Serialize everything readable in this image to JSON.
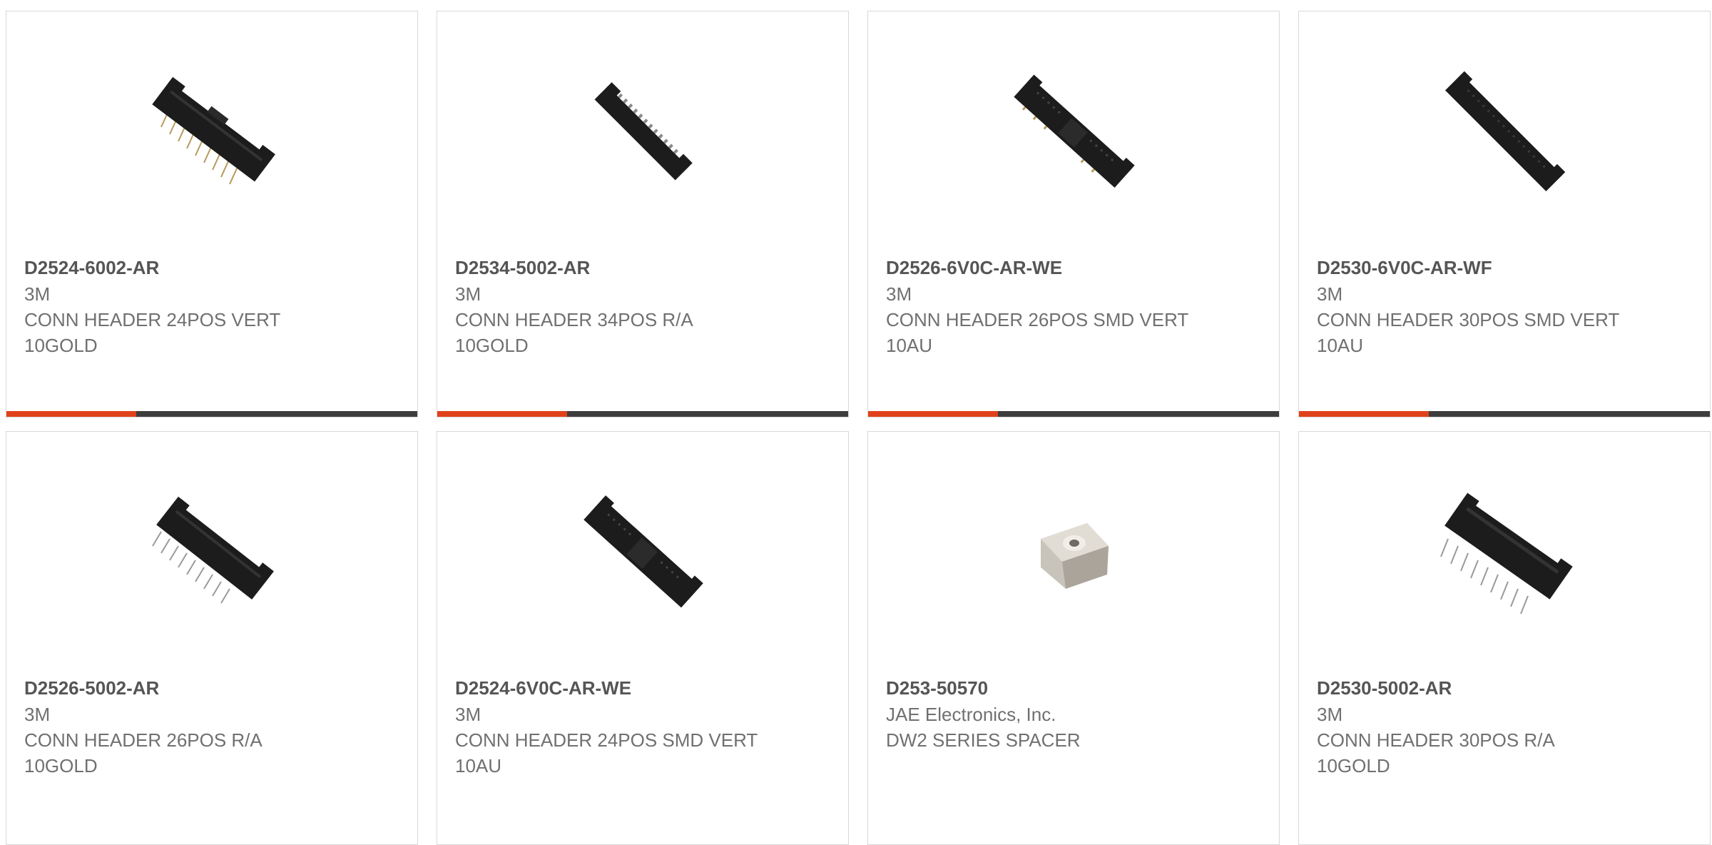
{
  "accent_color": "#e0421a",
  "bar_color": "#3d3d3d",
  "products": [
    {
      "part_number": "D2524-6002-AR",
      "manufacturer": "3M",
      "description": "CONN HEADER 24POS VERT 10GOLD",
      "image": "vertical-header-connector-image"
    },
    {
      "part_number": "D2534-5002-AR",
      "manufacturer": "3M",
      "description": "CONN HEADER 34POS R/A 10GOLD",
      "image": "right-angle-header-connector-image"
    },
    {
      "part_number": "D2526-6V0C-AR-WE",
      "manufacturer": "3M",
      "description": "CONN HEADER 26POS SMD VERT 10AU",
      "image": "smd-header-connector-image"
    },
    {
      "part_number": "D2530-6V0C-AR-WF",
      "manufacturer": "3M",
      "description": "CONN HEADER 30POS SMD VERT 10AU",
      "image": "smd-header-connector-image"
    },
    {
      "part_number": "D2526-5002-AR",
      "manufacturer": "3M",
      "description": "CONN HEADER 26POS R/A 10GOLD",
      "image": "right-angle-header-connector-image"
    },
    {
      "part_number": "D2524-6V0C-AR-WE",
      "manufacturer": "3M",
      "description": "CONN HEADER 24POS SMD VERT 10AU",
      "image": "smd-header-connector-image"
    },
    {
      "part_number": "D253-50570",
      "manufacturer": "JAE Electronics, Inc.",
      "description": "DW2 SERIES SPACER",
      "image": "metal-spacer-image"
    },
    {
      "part_number": "D2530-5002-AR",
      "manufacturer": "3M",
      "description": "CONN HEADER 30POS R/A 10GOLD",
      "image": "right-angle-header-connector-image"
    }
  ]
}
